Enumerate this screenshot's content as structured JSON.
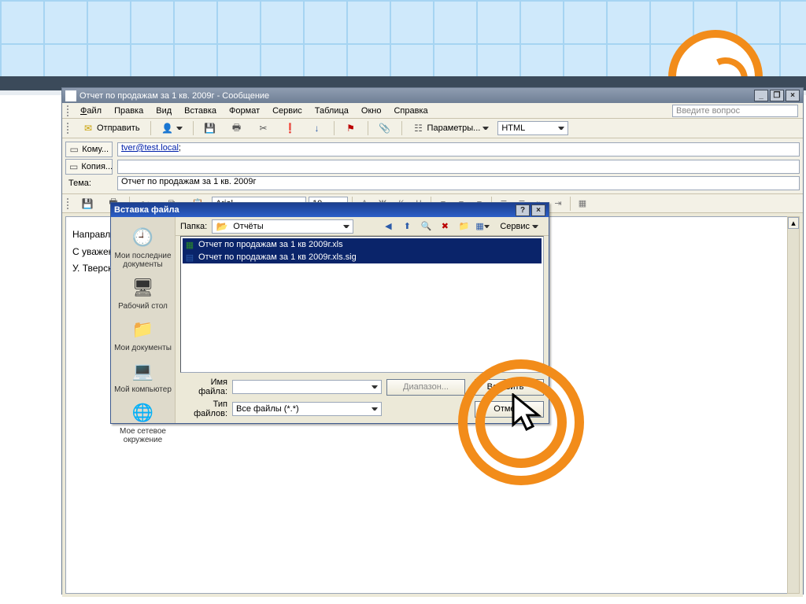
{
  "window": {
    "title": "Отчет по продажам за 1 кв. 2009г - Сообщение",
    "min": "_",
    "restore": "❐",
    "close": "×"
  },
  "menu": {
    "file": "Файл",
    "edit": "Правка",
    "view": "Вид",
    "insert": "Вставка",
    "format": "Формат",
    "tools": "Сервис",
    "table": "Таблица",
    "window": "Окно",
    "help": "Справка",
    "question_placeholder": "Введите вопрос"
  },
  "toolbar": {
    "send": "Отправить",
    "params": "Параметры...",
    "format_combo": "HTML"
  },
  "header": {
    "to_btn": "Кому...",
    "cc_btn": "Копия...",
    "subject_label": "Тема:",
    "to_value": "tver@test.local",
    "to_suffix": ";",
    "cc_value": "",
    "subject_value": "Отчет по продажам за 1 кв. 2009г"
  },
  "fmt": {
    "font": "Arial",
    "size": "10"
  },
  "body": {
    "line1": "Направляю",
    "line2": "С уважение",
    "line3": "У. Тверская"
  },
  "dialog": {
    "title": "Вставка файла",
    "help": "?",
    "close": "×",
    "folder_label": "Папка:",
    "folder_value": "Отчёты",
    "service": "Сервис",
    "side": {
      "recent": "Мои последние документы",
      "desktop": "Рабочий стол",
      "mydocs": "Мои документы",
      "mycomp": "Мой компьютер",
      "network": "Мое сетевое окружение"
    },
    "files": [
      "Отчет по продажам за 1 кв 2009г.xls",
      "Отчет по продажам за 1 кв 2009г.xls.sig"
    ],
    "filename_label": "Имя файла:",
    "filename_value": "",
    "filetype_label": "Тип файлов:",
    "filetype_value": "Все файлы (*.*)",
    "range_btn": "Диапазон...",
    "insert_btn": "Вставить",
    "cancel_btn": "Отмена"
  }
}
